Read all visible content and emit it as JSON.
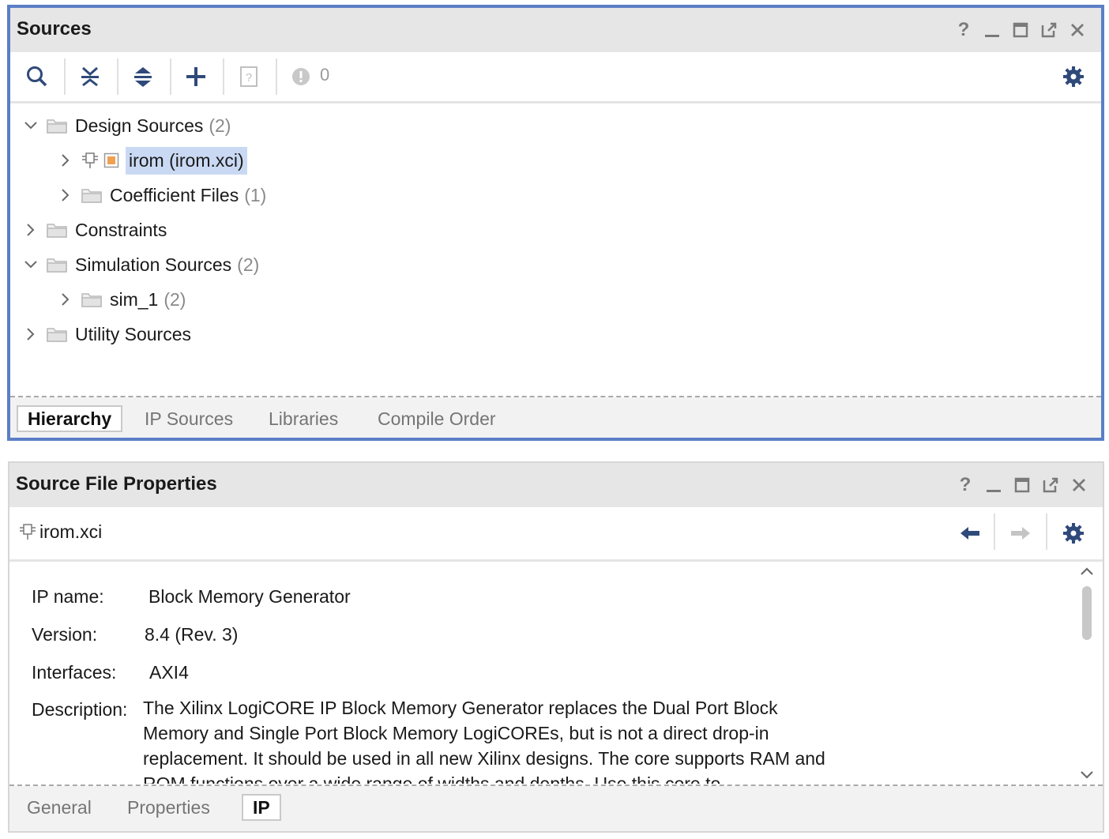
{
  "sources": {
    "title": "Sources",
    "window_controls": [
      "help-icon",
      "minimize-icon",
      "maximize-icon",
      "float-icon",
      "close-icon"
    ],
    "toolbar": {
      "buttons": [
        "search-icon",
        "collapse-all-icon",
        "expand-all-icon",
        "add-icon",
        "unknown-file-icon"
      ],
      "warning_count": "0",
      "settings": "gear-icon"
    },
    "tree": [
      {
        "label": "Design Sources",
        "count": "(2)",
        "expanded": true
      },
      {
        "label": "irom (irom.xci)",
        "count": "",
        "selected": true
      },
      {
        "label": "Coefficient Files",
        "count": "(1)"
      },
      {
        "label": "Constraints",
        "count": ""
      },
      {
        "label": "Simulation Sources",
        "count": "(2)",
        "expanded": true
      },
      {
        "label": "sim_1",
        "count": "(2)"
      },
      {
        "label": "Utility Sources",
        "count": ""
      }
    ],
    "tabs": [
      "Hierarchy",
      "IP Sources",
      "Libraries",
      "Compile Order"
    ],
    "active_tab": "Hierarchy"
  },
  "props": {
    "title": "Source File Properties",
    "file_name": "irom.xci",
    "labels": {
      "ip_name": "IP name:",
      "version": "Version:",
      "interfaces": "Interfaces:",
      "description": "Description:"
    },
    "values": {
      "ip_name": "Block Memory Generator",
      "version": "8.4 (Rev. 3)",
      "interfaces": "AXI4",
      "description": "The Xilinx LogiCORE IP Block Memory Generator replaces the Dual Port Block Memory and Single Port Block Memory LogiCOREs, but is not a direct drop-in replacement. It should be used in all new Xilinx designs. The core supports RAM and ROM functions over a wide range of widths and depths. Use this core to"
    },
    "tabs": [
      "General",
      "Properties",
      "IP"
    ],
    "active_tab": "IP"
  },
  "colors": {
    "active_border": "#5b7fc6",
    "selection": "#cad9f3",
    "icon_blue": "#2f4a7a",
    "accent_orange": "#f0a050"
  }
}
